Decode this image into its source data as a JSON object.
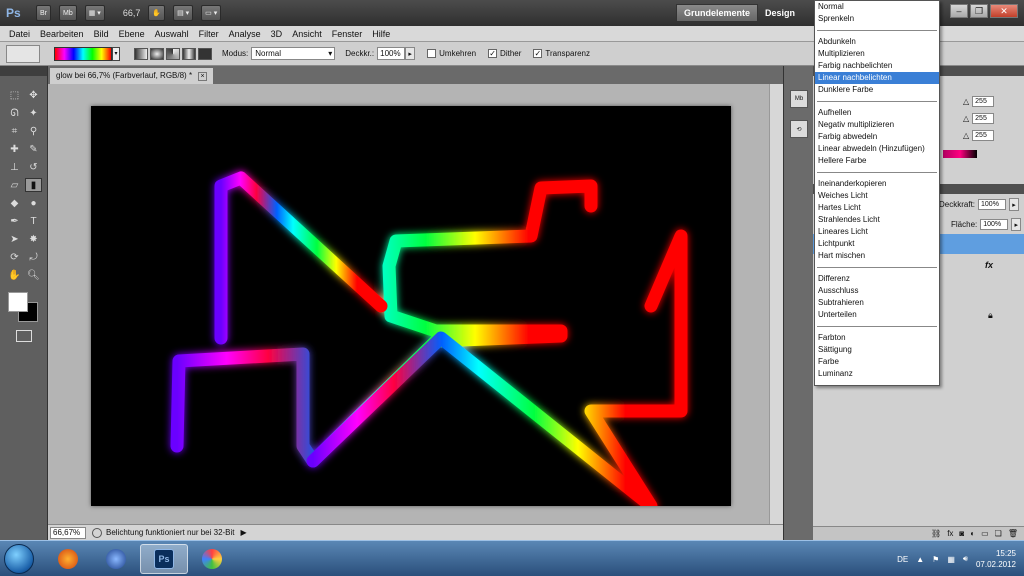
{
  "app": {
    "logo": "Ps",
    "bridge_label": "Br",
    "minibridge_label": "Mb",
    "zoom": "66,7",
    "workspaces": [
      "Grundelemente",
      "Design"
    ],
    "window_controls": [
      "minimize-icon",
      "restore-icon",
      "close-icon"
    ]
  },
  "menu": [
    "Datei",
    "Bearbeiten",
    "Bild",
    "Ebene",
    "Auswahl",
    "Filter",
    "Analyse",
    "3D",
    "Ansicht",
    "Fenster",
    "Hilfe"
  ],
  "options": {
    "modus_label": "Modus:",
    "modus_value": "Normal",
    "deckkraft_label": "Deckkr.:",
    "deckkraft_value": "100%",
    "umkehren_label": "Umkehren",
    "umkehren_checked": false,
    "dither_label": "Dither",
    "dither_checked": true,
    "transparenz_label": "Transparenz",
    "transparenz_checked": true,
    "gradient_colors": [
      "#ff0000",
      "#ff00ff",
      "#0000ff",
      "#00ffff",
      "#00ff00",
      "#ffff00",
      "#ff0000"
    ]
  },
  "document": {
    "tab_title": "glow bei 66,7% (Farbverlauf, RGB/8) *",
    "status_zoom": "66,67%",
    "status_text": "Belichtung funktioniert nur bei 32-Bit"
  },
  "panels": {
    "color_values": [
      "255",
      "255",
      "255"
    ],
    "deckkraft_label": "Deckkraft:",
    "deckkraft_value": "100%",
    "flaeche_label": "Fläche:",
    "flaeche_value": "100%",
    "fx_label": "fx"
  },
  "blend_modes": {
    "groups": [
      [
        "Normal",
        "Sprenkeln"
      ],
      [
        "Abdunkeln",
        "Multiplizieren",
        "Farbig nachbelichten",
        "Linear nachbelichten",
        "Dunklere Farbe"
      ],
      [
        "Aufhellen",
        "Negativ multiplizieren",
        "Farbig abwedeln",
        "Linear abwedeln (Hinzufügen)",
        "Hellere Farbe"
      ],
      [
        "Ineinanderkopieren",
        "Weiches Licht",
        "Hartes Licht",
        "Strahlendes Licht",
        "Lineares Licht",
        "Lichtpunkt",
        "Hart mischen"
      ],
      [
        "Differenz",
        "Ausschluss",
        "Subtrahieren",
        "Unterteilen"
      ],
      [
        "Farbton",
        "Sättigung",
        "Farbe",
        "Luminanz"
      ]
    ],
    "highlighted": "Linear nachbelichten"
  },
  "taskbar": {
    "apps": [
      "firefox-icon",
      "thunderbird-icon",
      "photoshop-icon",
      "paint-icon"
    ],
    "active_app": "Ps",
    "language": "DE",
    "time": "15:25",
    "date": "07.02.2012"
  }
}
